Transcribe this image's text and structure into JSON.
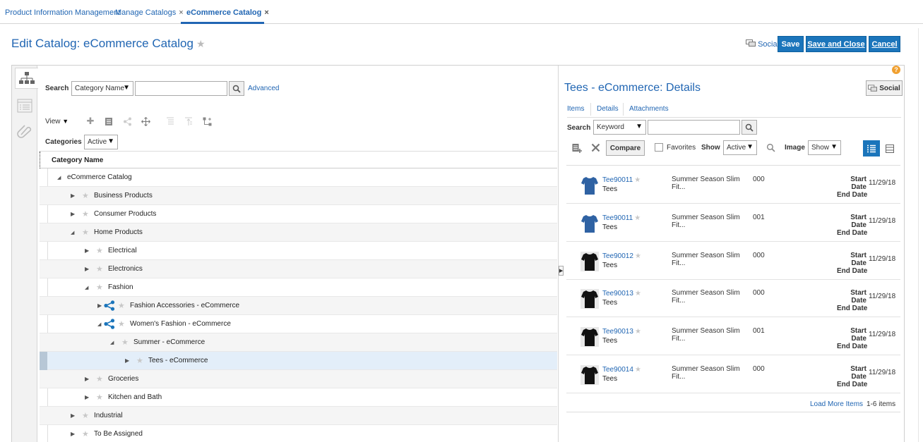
{
  "top_tabs": [
    {
      "label": "Product Information Management"
    },
    {
      "label": "Manage Catalogs",
      "close": "×"
    },
    {
      "label": "eCommerce Catalog",
      "close": "×"
    }
  ],
  "header": {
    "title": "Edit Catalog: eCommerce Catalog",
    "social": "Social",
    "save": "Save",
    "save_close": "Save and Close",
    "cancel": "Cancel"
  },
  "left": {
    "search_label": "Search",
    "search_by": "Category Name",
    "search_value": "",
    "advanced": "Advanced",
    "view": "View",
    "categories_label": "Categories",
    "categories_filter": "Active",
    "column_header": "Category Name",
    "tree": [
      {
        "label": "eCommerce Catalog",
        "level": 0,
        "state": "expanded",
        "star": false,
        "shared": false
      },
      {
        "label": "Business Products",
        "level": 1,
        "state": "collapsed",
        "star": true,
        "shared": false
      },
      {
        "label": "Consumer Products",
        "level": 1,
        "state": "collapsed",
        "star": true,
        "shared": false
      },
      {
        "label": "Home Products",
        "level": 1,
        "state": "expanded",
        "star": true,
        "shared": false
      },
      {
        "label": "Electrical",
        "level": 2,
        "state": "collapsed",
        "star": true,
        "shared": false
      },
      {
        "label": "Electronics",
        "level": 2,
        "state": "collapsed",
        "star": true,
        "shared": false
      },
      {
        "label": "Fashion",
        "level": 2,
        "state": "expanded",
        "star": true,
        "shared": false
      },
      {
        "label": "Fashion Accessories - eCommerce",
        "level": 3,
        "state": "collapsed",
        "star": true,
        "shared": true
      },
      {
        "label": "Women's Fashion - eCommerce",
        "level": 3,
        "state": "expanded",
        "star": true,
        "shared": true
      },
      {
        "label": "Summer - eCommerce",
        "level": 4,
        "state": "expanded",
        "star": true,
        "shared": false
      },
      {
        "label": "Tees - eCommerce",
        "level": 5,
        "state": "collapsed",
        "star": true,
        "shared": false,
        "selected": true
      },
      {
        "label": "Groceries",
        "level": 2,
        "state": "collapsed",
        "star": true,
        "shared": false
      },
      {
        "label": "Kitchen and Bath",
        "level": 2,
        "state": "collapsed",
        "star": true,
        "shared": false
      },
      {
        "label": "Industrial",
        "level": 1,
        "state": "collapsed",
        "star": true,
        "shared": false
      },
      {
        "label": "To Be Assigned",
        "level": 1,
        "state": "collapsed",
        "star": true,
        "shared": false
      }
    ]
  },
  "right": {
    "title": "Tees - eCommerce: Details",
    "social": "Social",
    "help": "?",
    "tabs": [
      {
        "label": "Items"
      },
      {
        "label": "Details"
      },
      {
        "label": "Attachments"
      }
    ],
    "search_label": "Search",
    "search_by": "Keyword",
    "search_value": "",
    "compare": "Compare",
    "favorites": "Favorites",
    "show_label": "Show",
    "show_value": "Active",
    "image_label": "Image",
    "image_value": "Show",
    "items": [
      {
        "code": "Tee90011",
        "category": "Tees",
        "desc": "Summer Season Slim Fit...",
        "version": "000",
        "start_label": "Start Date",
        "start": "11/29/18",
        "end_label": "End Date",
        "color": "blue"
      },
      {
        "code": "Tee90011",
        "category": "Tees",
        "desc": "Summer Season Slim Fit...",
        "version": "001",
        "start_label": "Start Date",
        "start": "11/29/18",
        "end_label": "End Date",
        "color": "blue"
      },
      {
        "code": "Tee90012",
        "category": "Tees",
        "desc": "Summer Season Slim Fit...",
        "version": "000",
        "start_label": "Start Date",
        "start": "11/29/18",
        "end_label": "End Date",
        "color": "black"
      },
      {
        "code": "Tee90013",
        "category": "Tees",
        "desc": "Summer Season Slim Fit...",
        "version": "000",
        "start_label": "Start Date",
        "start": "11/29/18",
        "end_label": "End Date",
        "color": "black"
      },
      {
        "code": "Tee90013",
        "category": "Tees",
        "desc": "Summer Season Slim Fit...",
        "version": "001",
        "start_label": "Start Date",
        "start": "11/29/18",
        "end_label": "End Date",
        "color": "black"
      },
      {
        "code": "Tee90014",
        "category": "Tees",
        "desc": "Summer Season Slim Fit...",
        "version": "000",
        "start_label": "Start Date",
        "start": "11/29/18",
        "end_label": "End Date",
        "color": "black"
      }
    ],
    "load_more": "Load More Items",
    "count": "1-6 items"
  },
  "colors": {
    "accent": "#2166b3",
    "button": "#1b75bb",
    "tee_blue": "#2f62a3",
    "tee_black": "#111111"
  }
}
